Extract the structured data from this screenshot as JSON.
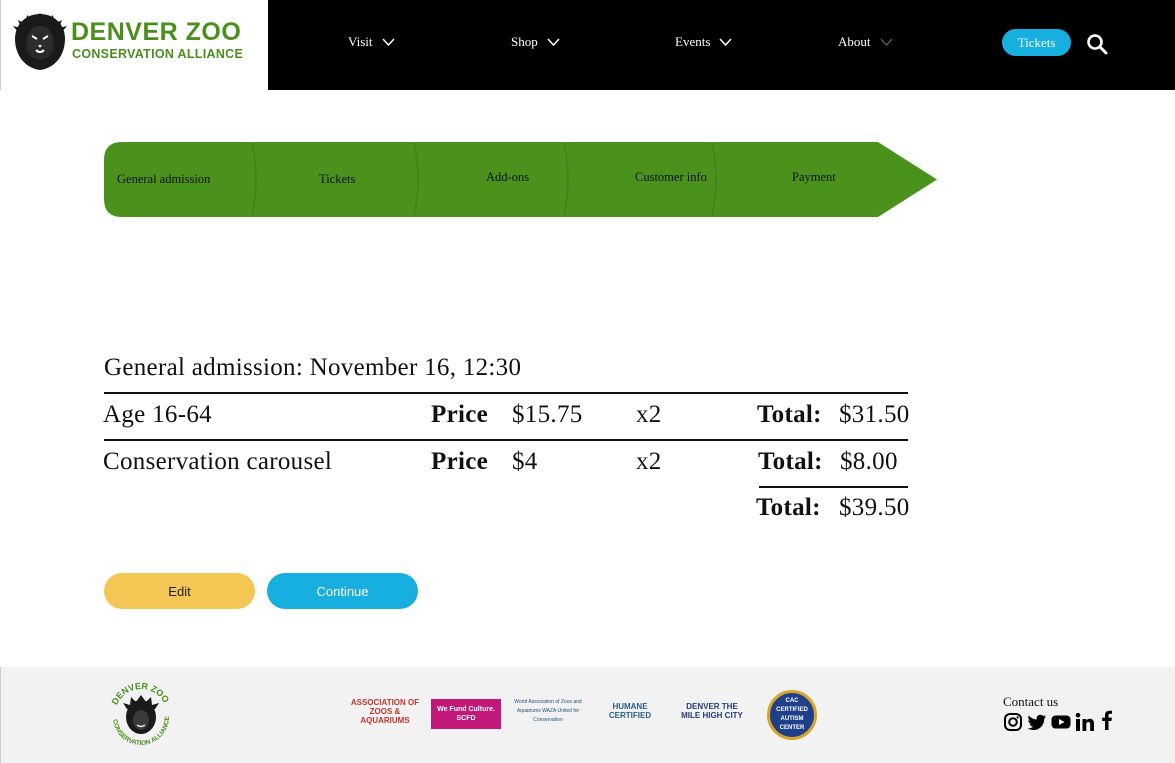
{
  "header": {
    "logo": {
      "title": "DENVER ZOO",
      "subtitle": "CONSERVATION ALLIANCE"
    },
    "nav": [
      {
        "label": "Visit"
      },
      {
        "label": "Shop"
      },
      {
        "label": "Events"
      },
      {
        "label": "About"
      }
    ],
    "tickets_label": "Tickets",
    "search_icon": "search-icon"
  },
  "steps": [
    {
      "label": "General admission"
    },
    {
      "label": "Tickets"
    },
    {
      "label": "Add-ons"
    },
    {
      "label": "Customer info"
    },
    {
      "label": "Payment"
    }
  ],
  "order": {
    "title": "General admission: November 16, 12:30",
    "rows": [
      {
        "name": "Age 16-64",
        "price_label": "Price",
        "price": "$15.75",
        "qty": "x2",
        "total_label": "Total:",
        "total": "$31.50"
      },
      {
        "name": "Conservation carousel",
        "price_label": "Price",
        "price": "$4",
        "qty": "x2",
        "total_label": "Total:",
        "total": "$8.00"
      }
    ],
    "grand_total_label": "Total:",
    "grand_total": "$39.50"
  },
  "buttons": {
    "edit": "Edit",
    "continue": "Continue"
  },
  "footer": {
    "seal_text": "DENVER ZOO CONSERVATION ALLIANCE",
    "partners": [
      {
        "name": "ASSOCIATION OF ZOOS & AQUARIUMS"
      },
      {
        "name": "We Fund Culture. SCFD"
      },
      {
        "name": "World Association of Zoos and Aquariums WAZA United for Conservation"
      },
      {
        "name": "HUMANE CERTIFIED"
      },
      {
        "name": "DENVER THE MILE HIGH CITY"
      },
      {
        "name": "CAC CERTIFIED AUTISM CENTER"
      }
    ],
    "contact_label": "Contact us",
    "social": [
      "instagram-icon",
      "twitter-icon",
      "youtube-icon",
      "linkedin-icon",
      "facebook-icon"
    ]
  },
  "colors": {
    "brand_green": "#4a8f1c",
    "step_green": "#4b921d",
    "accent_blue": "#17aee0",
    "edit_yellow": "#f4c653",
    "header_black": "#000000"
  }
}
